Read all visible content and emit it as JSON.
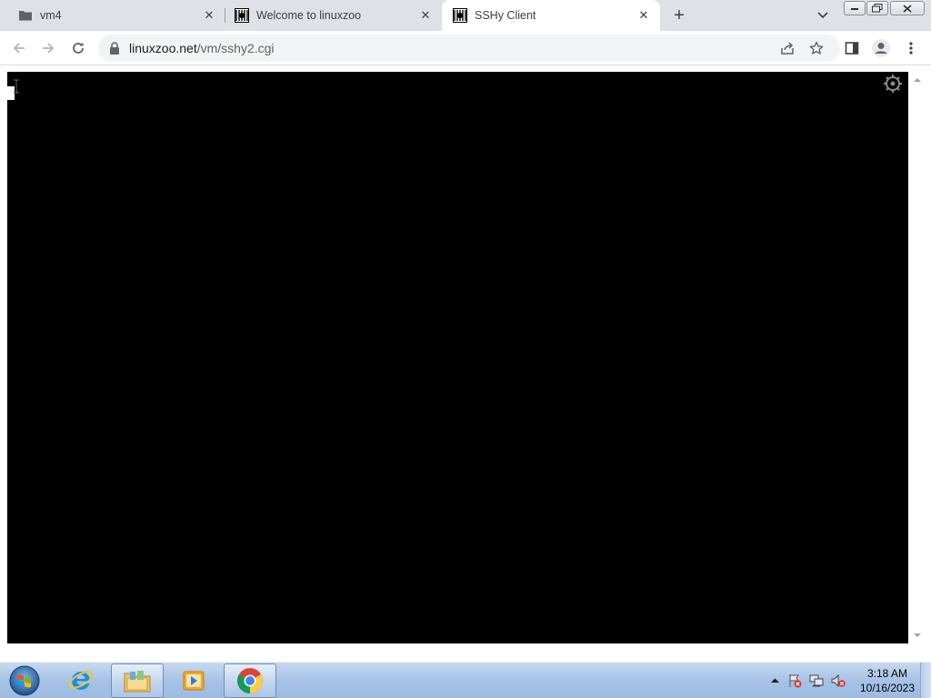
{
  "browser": {
    "tabs": [
      {
        "title": "vm4",
        "icon": "folder-icon",
        "active": false
      },
      {
        "title": "Welcome to linuxzoo",
        "icon": "linuxzoo-favicon",
        "active": false
      },
      {
        "title": "SSHy Client",
        "icon": "linuxzoo-favicon",
        "active": true
      }
    ],
    "new_tab_label": "+",
    "close_glyph": "✕",
    "address": {
      "domain": "linuxzoo.net",
      "path": "/vm/sshy2.cgi"
    }
  },
  "page": {
    "terminal": {
      "background": "#000000",
      "cursor_color": "#ffffff"
    }
  },
  "taskbar": {
    "items": [
      {
        "name": "internet-explorer",
        "icon": "internet-explorer-icon"
      },
      {
        "name": "windows-explorer",
        "icon": "folder-library-icon"
      },
      {
        "name": "media-player",
        "icon": "media-player-icon"
      },
      {
        "name": "google-chrome",
        "icon": "chrome-icon"
      }
    ],
    "clock": {
      "time": "3:18 AM",
      "date": "10/16/2023"
    }
  },
  "colors": {
    "tabstrip_bg": "#dee1e6",
    "omnibox_bg": "#f1f3f4",
    "taskbar_bg": "#a7c3e6"
  }
}
